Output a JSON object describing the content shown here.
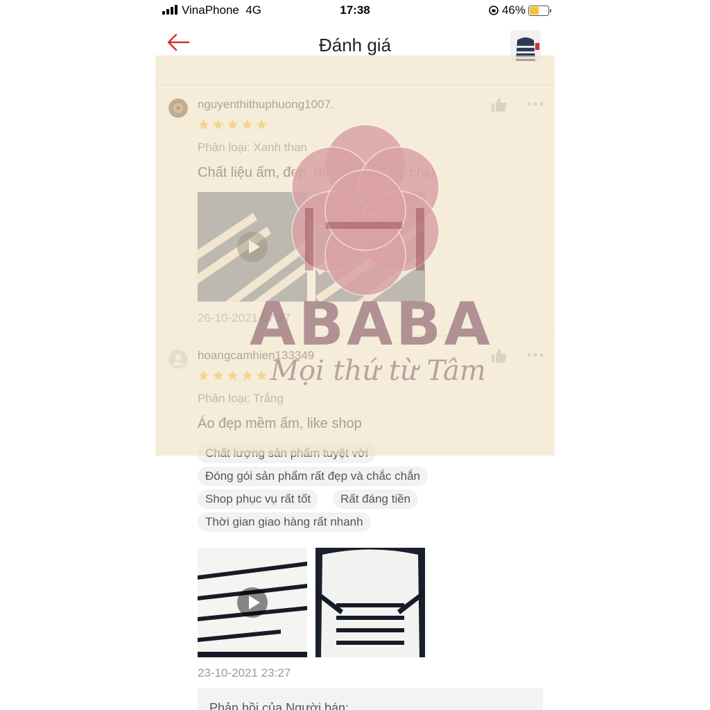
{
  "status": {
    "carrier": "VinaPhone",
    "network": "4G",
    "time": "17:38",
    "battery": "46%",
    "battery_level": 0.46
  },
  "header": {
    "title": "Đánh giá",
    "back_icon": "arrow-left-icon",
    "accent": "#d0302a"
  },
  "reviews": [
    {
      "user": "nguyenthithuphuong1007.",
      "rating": 5,
      "variant": "Phân loại: Xanh than",
      "comment": "Chất liệu ấm, đẹp, dày mặc rất dễ chịu",
      "date": "26-10-2021 07:27"
    },
    {
      "user": "hoangcamhien133349",
      "rating": 5,
      "variant": "Phân loại: Trắng",
      "comment": "Áo đẹp mềm ấm, like shop",
      "tags": [
        "Chất lượng sản phẩm tuyệt vời",
        "Đóng gói sản phẩm rất đẹp và chắc chắn",
        "Shop phục vụ rất tốt",
        "Rất đáng tiền",
        "Thời gian giao hàng rất nhanh"
      ],
      "date": "23-10-2021 23:27",
      "seller_reply": "Phản hồi của Người bán:"
    }
  ],
  "watermark": {
    "brand": "ABABA",
    "slogan": "Mọi thứ từ Tâm"
  },
  "colors": {
    "star": "#f4c531",
    "tint": "#f0e1c3",
    "watermark_flower": "#d9a2a4"
  }
}
